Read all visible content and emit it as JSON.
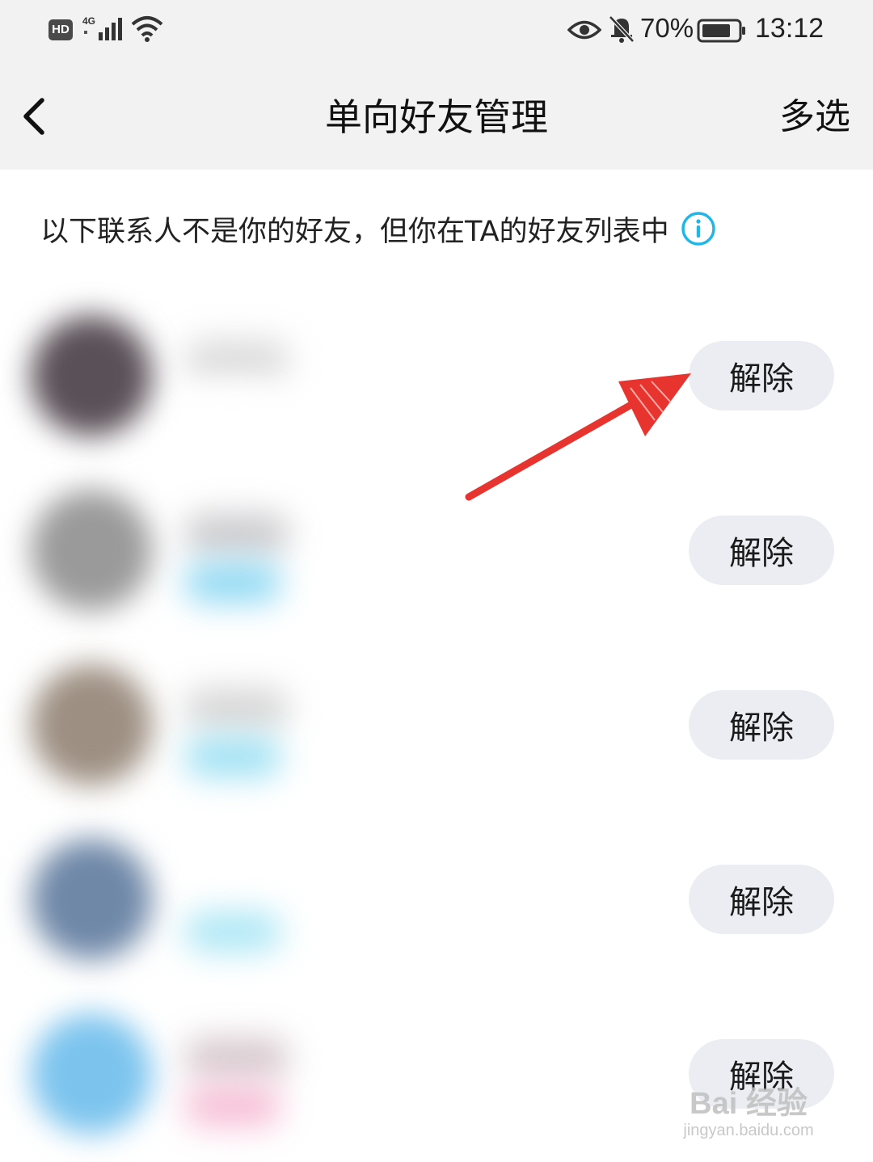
{
  "status_bar": {
    "hd_badge": "HD",
    "network": "4G",
    "battery_percent": "70%",
    "time": "13:12"
  },
  "nav": {
    "title": "单向好友管理",
    "right_action": "多选",
    "back_icon": "chevron-left-icon"
  },
  "notice": {
    "text": "以下联系人不是你的好友，但你在TA的好友列表中",
    "icon": "info-icon",
    "icon_color": "#1fb6e8"
  },
  "contacts": [
    {
      "action_label": "解除",
      "avatar_color": "#5a5058",
      "name_color": "#d0d0d0",
      "sub_color": "#ffffff"
    },
    {
      "action_label": "解除",
      "avatar_color": "#9a9a9a",
      "name_color": "#b8b8bc",
      "sub_color": "#7ed3f2"
    },
    {
      "action_label": "解除",
      "avatar_color": "#9d8f82",
      "name_color": "#c8c8c8",
      "sub_color": "#8fdcf2"
    },
    {
      "action_label": "解除",
      "avatar_color": "#6f88a8",
      "name_color": "#ffffff",
      "sub_color": "#9fe3f4"
    },
    {
      "action_label": "解除",
      "avatar_color": "#7cc4ee",
      "name_color": "#c9b6bd",
      "sub_color": "#f5b3cf"
    }
  ],
  "annotation": {
    "arrow_color": "#e8342f"
  },
  "watermark": {
    "brand": "Bai 经验",
    "url": "jingyan.baidu.com"
  }
}
